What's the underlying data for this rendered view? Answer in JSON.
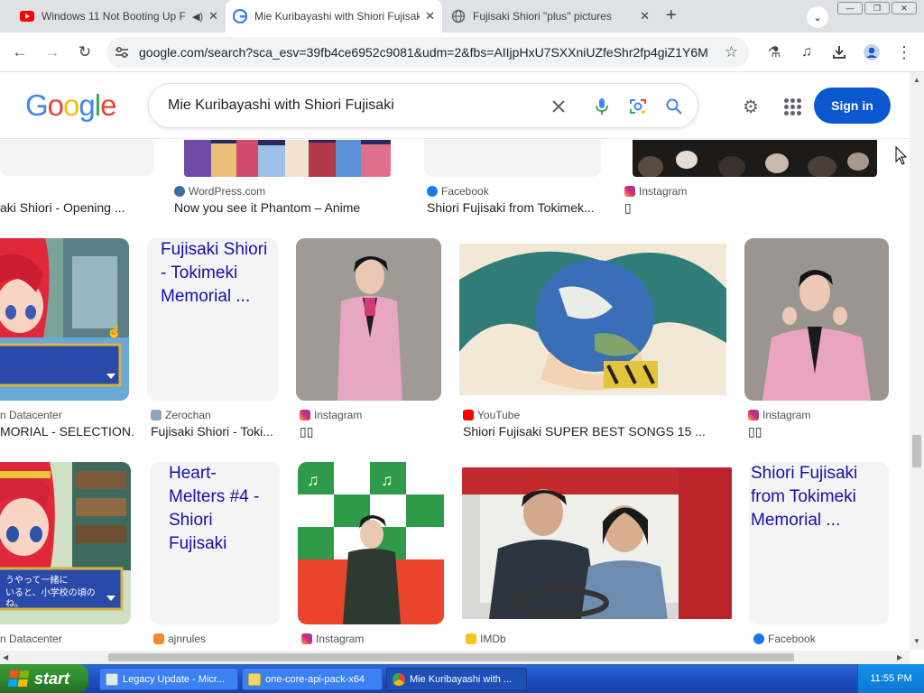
{
  "browser": {
    "tabs": [
      {
        "title": "Windows 11 Not Booting Up F",
        "speaker": "◀)"
      },
      {
        "title": "Mie Kuribayashi with Shiori Fujisak"
      },
      {
        "title": "Fujisaki Shiori \"plus\" pictures"
      }
    ],
    "url": "google.com/search?sca_esv=39fb4ce6952c9081&udm=2&fbs=AIIjpHxU7SXXniUZfeShr2fp4giZ1Y6M...",
    "window_controls": [
      "—",
      "❐",
      "✕"
    ]
  },
  "google": {
    "logo": [
      "G",
      "o",
      "o",
      "g",
      "l",
      "e"
    ],
    "logo_colors": [
      "#4285F4",
      "#EA4335",
      "#FBBC05",
      "#4285F4",
      "#34A853",
      "#EA4335"
    ],
    "query": "Mie Kuribayashi with Shiori Fujisaki",
    "signin_label": "Sign in"
  },
  "results": {
    "row1": [
      {
        "caption": "aki Shiori - Opening ..."
      },
      {
        "source": "WordPress.com",
        "caption": "Now you see it Phantom – Anime"
      },
      {
        "source": "Facebook",
        "caption": "Shiori Fujisaki from Tokimek..."
      },
      {
        "source": "Instagram",
        "caption": "▯"
      }
    ],
    "row2": [
      {
        "source": "n Datacenter",
        "caption": "MORIAL - SELECTION..."
      },
      {
        "alt": "Fujisaki Shiori - Tokimeki Memorial ...",
        "source": "Zerochan",
        "caption": "Fujisaki Shiori - Toki..."
      },
      {
        "source": "Instagram",
        "caption": "▯▯"
      },
      {
        "source": "YouTube",
        "caption": "Shiori Fujisaki SUPER BEST SONGS 15 ..."
      },
      {
        "source": "Instagram",
        "caption": "▯▯"
      }
    ],
    "row3": [
      {
        "source": "n Datacenter"
      },
      {
        "alt": "Heart-Melters #4 - Shiori Fujisaki",
        "source": "ajnrules"
      },
      {
        "source": "Instagram"
      },
      {
        "source": "IMDb"
      },
      {
        "alt": "Shiori Fujisaki from Tokimeki Memorial ...",
        "source": "Facebook"
      }
    ]
  },
  "taskbar": {
    "start_label": "start",
    "tasks": [
      "Legacy Update - Micr...",
      "one-core-api-pack-x64",
      "Mie Kuribayashi with ..."
    ],
    "clock": "11:55 PM"
  }
}
